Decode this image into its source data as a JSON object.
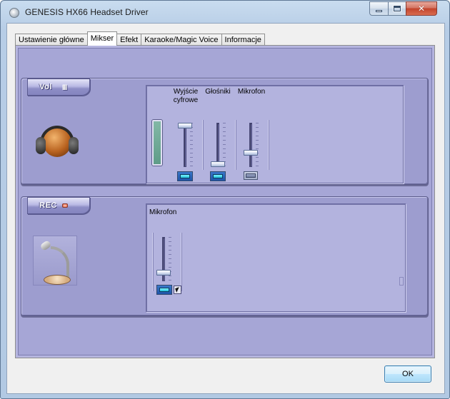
{
  "window": {
    "title": "GENESIS HX66 Headset Driver",
    "controls": {
      "minimize": "minimize-icon",
      "maximize": "maximize-icon",
      "close": "close-icon"
    }
  },
  "tabs": [
    {
      "label": "Ustawienie główne",
      "active": false
    },
    {
      "label": "Mikser",
      "active": true
    },
    {
      "label": "Efekt",
      "active": false
    },
    {
      "label": "Karaoke/Magic Voice",
      "active": false
    },
    {
      "label": "Informacje",
      "active": false
    }
  ],
  "vol_group": {
    "badge": "Vol",
    "badge_marks": "III",
    "channels": [
      {
        "label_line1": "Wyjście",
        "label_line2": "cyfrowe",
        "level": 1.0,
        "muted": false
      },
      {
        "label_line1": "Głośniki",
        "label_line2": "",
        "level": 0.0,
        "muted": false
      },
      {
        "label_line1": "Mikrofon",
        "label_line2": "",
        "level": 0.3,
        "muted": true
      }
    ]
  },
  "rec_group": {
    "badge": "REC",
    "channels": [
      {
        "label": "Mikrofon",
        "level": 0.15,
        "selected": true
      }
    ]
  },
  "buttons": {
    "ok": "OK"
  },
  "colors": {
    "panel": "#a6a6d6",
    "group": "#9d9dcf",
    "accent": "#1f55a8"
  }
}
